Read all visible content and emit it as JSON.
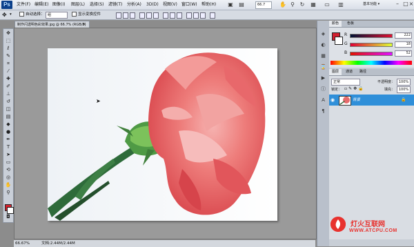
{
  "menu": {
    "logo": "Ps",
    "items": [
      "文件(F)",
      "编辑(E)",
      "图像(I)",
      "图层(L)",
      "选择(S)",
      "滤镜(T)",
      "分析(A)",
      "3D(D)",
      "视图(V)",
      "窗口(W)",
      "帮助(H)"
    ],
    "zoom": "66.7",
    "workspace": "基本功能 ▾",
    "icons": [
      "hand-icon",
      "zoom-icon",
      "rotate-icon",
      "grid-icon",
      "screen-mode-icon",
      "arrange-icon"
    ]
  },
  "options": {
    "auto_select_label": "自动选择：",
    "auto_select_value": "组",
    "show_transform_label": "显示变换控件"
  },
  "document": {
    "tab_title": "制作闪透明色彩效果.jpg @ 66.7% (RGB/8)",
    "close": "×",
    "zoom_level": "66.67%",
    "doc_info": "文档:2.44M/2.44M"
  },
  "color_panel": {
    "tabs": [
      "颜色",
      "色板"
    ],
    "channels": [
      {
        "label": "R",
        "value": "222",
        "color": "#de1e34"
      },
      {
        "label": "G",
        "value": "18",
        "color": "#12c012"
      },
      {
        "label": "B",
        "value": "52",
        "color": "#3434ff"
      }
    ],
    "foreground": "#d21f2f"
  },
  "layers_panel": {
    "tabs": [
      "图层",
      "通道",
      "路径"
    ],
    "blend_mode": "正常",
    "opacity_label": "不透明度：",
    "opacity": "100%",
    "lock_label": "锁定：",
    "fill_label": "填充：",
    "fill": "100%",
    "layer_name": "背景",
    "layer_lock": "🔒"
  },
  "watermark": {
    "title": "灯火互联网",
    "url": "WWW.ATCPU.COM"
  }
}
